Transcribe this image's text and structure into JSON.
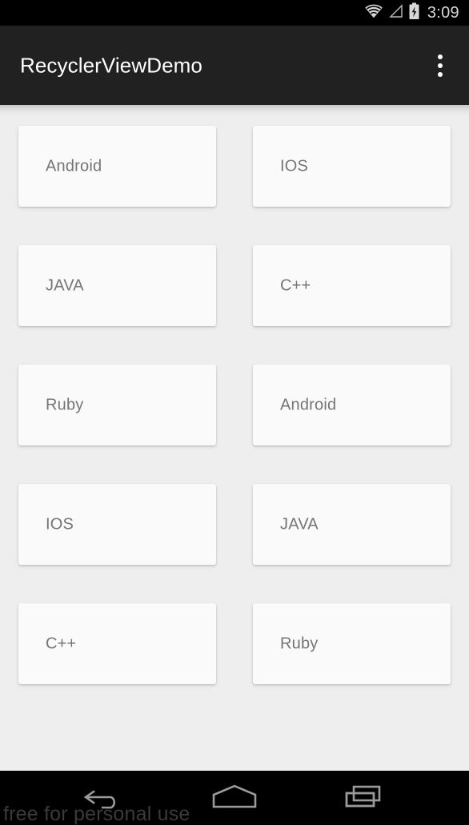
{
  "status_bar": {
    "time": "3:09",
    "icons": [
      "wifi-icon",
      "cell-signal-icon",
      "battery-charging-icon"
    ],
    "background_color": "#000000",
    "text_color": "#d8d8d8"
  },
  "app_bar": {
    "title": "RecyclerViewDemo",
    "background_color": "#212121",
    "title_color": "#ffffff",
    "overflow_label": "More options"
  },
  "content": {
    "background_color": "#eeeeee",
    "card_background_color": "#fafafa",
    "card_text_color": "#757575",
    "columns": 2,
    "cards": [
      {
        "label": "Android",
        "col": 0,
        "row": 0
      },
      {
        "label": "IOS",
        "col": 1,
        "row": 0
      },
      {
        "label": "JAVA",
        "col": 0,
        "row": 1
      },
      {
        "label": "C++",
        "col": 1,
        "row": 1
      },
      {
        "label": "Ruby",
        "col": 0,
        "row": 2
      },
      {
        "label": "Android",
        "col": 1,
        "row": 2
      },
      {
        "label": "IOS",
        "col": 0,
        "row": 3
      },
      {
        "label": "JAVA",
        "col": 1,
        "row": 3
      },
      {
        "label": "C++",
        "col": 0,
        "row": 4
      },
      {
        "label": "Ruby",
        "col": 1,
        "row": 4
      }
    ]
  },
  "nav_bar": {
    "background_color": "#000000",
    "icon_color": "#9a9a9a",
    "buttons": [
      {
        "name": "back-icon",
        "label": "Back"
      },
      {
        "name": "home-icon",
        "label": "Home"
      },
      {
        "name": "recents-icon",
        "label": "Recent apps"
      }
    ]
  },
  "watermark": {
    "text": "free for personal use"
  }
}
